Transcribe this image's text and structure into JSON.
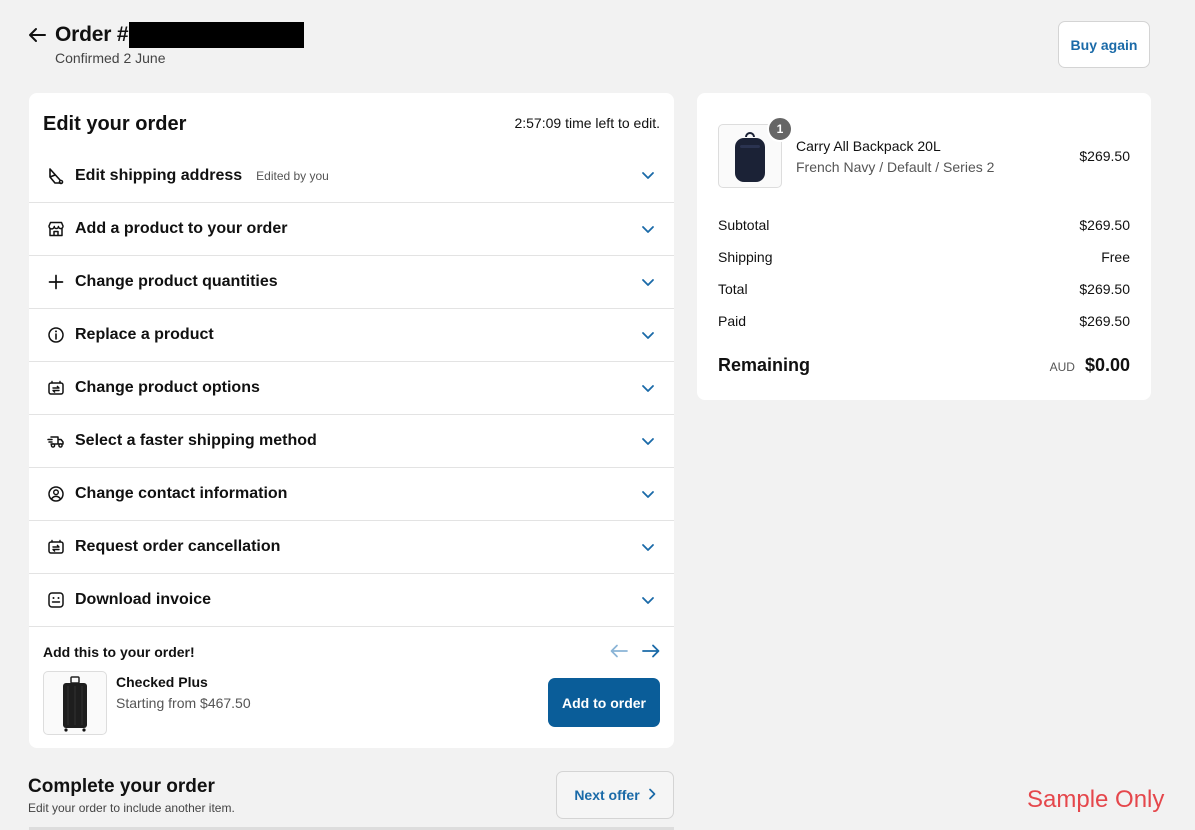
{
  "header": {
    "order_title": "Order #",
    "confirmed": "Confirmed 2 June",
    "buy_again": "Buy again"
  },
  "edit": {
    "heading": "Edit your order",
    "time_left": "2:57:09 time left to edit.",
    "rows": [
      {
        "label": "Edit shipping address",
        "sub": "Edited by you",
        "icon": "truck-edit-icon"
      },
      {
        "label": "Add a product to your order",
        "sub": "",
        "icon": "store-icon"
      },
      {
        "label": "Change product quantities",
        "sub": "",
        "icon": "plus-icon"
      },
      {
        "label": "Replace a product",
        "sub": "",
        "icon": "info-icon"
      },
      {
        "label": "Change product options",
        "sub": "",
        "icon": "cart-swap-icon"
      },
      {
        "label": "Select a faster shipping method",
        "sub": "",
        "icon": "fast-truck-icon"
      },
      {
        "label": "Change contact information",
        "sub": "",
        "icon": "person-icon"
      },
      {
        "label": "Request order cancellation",
        "sub": "",
        "icon": "cart-swap-icon"
      },
      {
        "label": "Download invoice",
        "sub": "",
        "icon": "receipt-icon"
      }
    ]
  },
  "upsell": {
    "title": "Add this to your order!",
    "product_name": "Checked Plus",
    "product_price": "Starting from $467.50",
    "add_button": "Add to order"
  },
  "complete": {
    "title": "Complete your order",
    "subtitle": "Edit your order to include another item.",
    "next_offer": "Next offer"
  },
  "summary": {
    "product": {
      "name": "Carry All Backpack 20L",
      "variant": "French Navy / Default / Series 2",
      "price": "$269.50",
      "quantity": "1"
    },
    "lines": [
      {
        "label": "Subtotal",
        "value": "$269.50"
      },
      {
        "label": "Shipping",
        "value": "Free"
      },
      {
        "label": "Total",
        "value": "$269.50"
      },
      {
        "label": "Paid",
        "value": "$269.50"
      }
    ],
    "remaining_label": "Remaining",
    "currency": "AUD",
    "remaining_value": "$0.00"
  },
  "watermark": "Sample Only",
  "colors": {
    "accent": "#1a6aa8",
    "primary_button": "#0a5d99",
    "background": "#f2f2f2",
    "watermark": "#e5474c"
  }
}
